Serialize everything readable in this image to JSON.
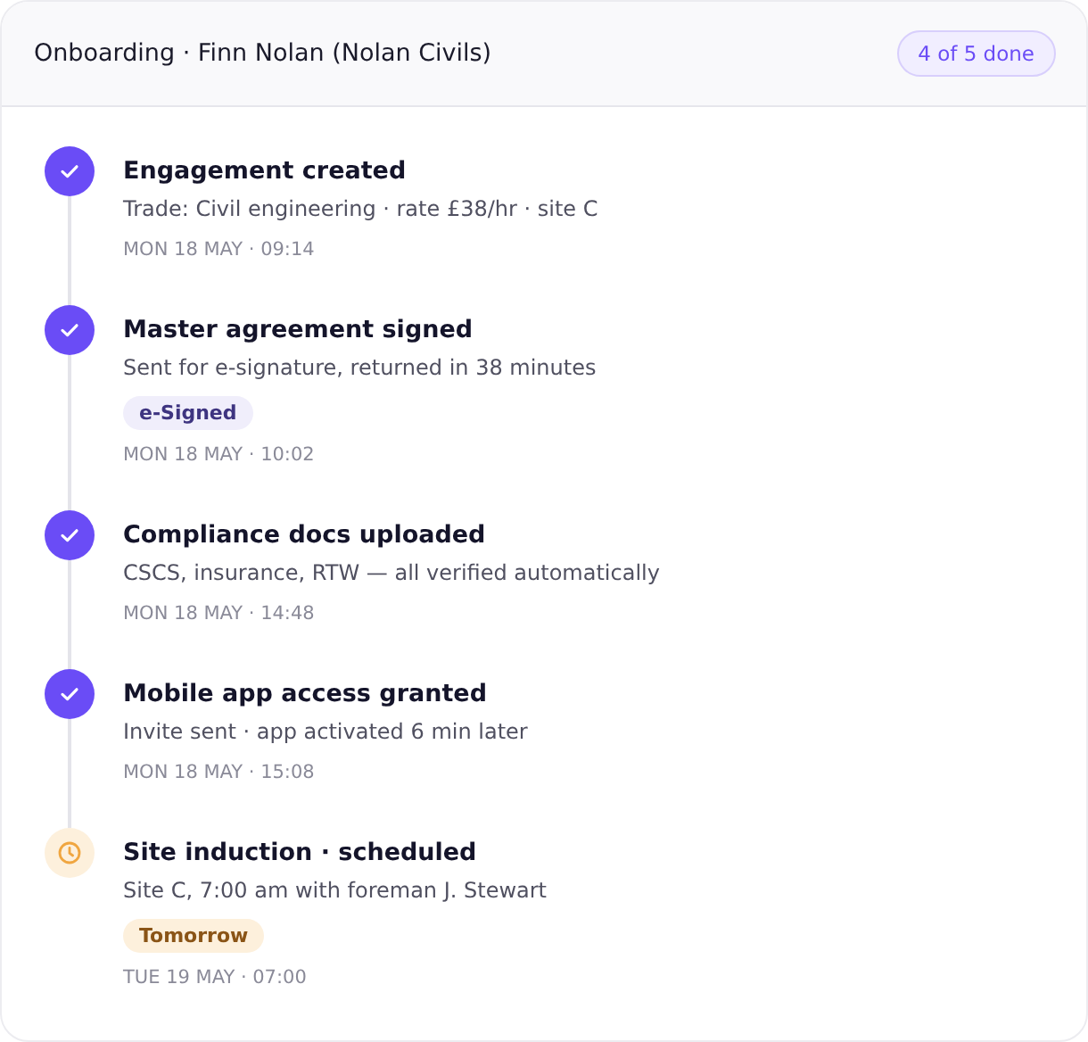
{
  "header": {
    "title": "Onboarding · Finn Nolan (Nolan Civils)",
    "progress": "4 of 5 done"
  },
  "steps": [
    {
      "kind": "done",
      "title": "Engagement created",
      "detail": "Trade: Civil engineering · rate £38/hr · site C",
      "time": "MON 18 MAY · 09:14"
    },
    {
      "kind": "done",
      "title": "Master agreement signed",
      "detail": "Sent for e-signature, returned in 38 minutes",
      "tag": {
        "kind": "signed",
        "label": "e-Signed"
      },
      "time": "MON 18 MAY · 10:02"
    },
    {
      "kind": "done",
      "title": "Compliance docs uploaded",
      "detail": "CSCS, insurance, RTW — all verified automatically",
      "time": "MON 18 MAY · 14:48"
    },
    {
      "kind": "done",
      "title": "Mobile app access granted",
      "detail": "Invite sent · app activated 6 min later",
      "time": "MON 18 MAY · 15:08"
    },
    {
      "kind": "scheduled",
      "title": "Site induction · scheduled",
      "detail": "Site C, 7:00 am with foreman J. Stewart",
      "tag": {
        "kind": "soon",
        "label": "Tomorrow"
      },
      "time": "TUE 19 MAY · 07:00"
    }
  ]
}
